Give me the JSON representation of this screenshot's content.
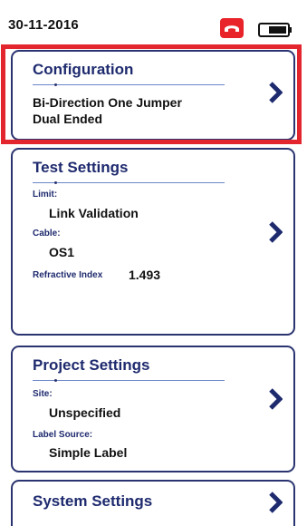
{
  "status": {
    "date": "30-11-2016",
    "phone_icon": "phone-hangup-icon",
    "battery_icon": "battery-icon",
    "accent_color": "#e8242a"
  },
  "configuration": {
    "title": "Configuration",
    "line1": "Bi-Direction One Jumper",
    "line2": "Dual Ended"
  },
  "test_settings": {
    "title": "Test Settings",
    "limit_label": "Limit:",
    "limit_value": "Link Validation",
    "cable_label": "Cable:",
    "cable_value": "OS1",
    "ri_label": "Refractive Index",
    "ri_value": "1.493"
  },
  "project_settings": {
    "title": "Project Settings",
    "site_label": "Site:",
    "site_value": "Unspecified",
    "label_source_label": "Label Source:",
    "label_source_value": "Simple Label"
  },
  "system_settings": {
    "title": "System Settings"
  }
}
